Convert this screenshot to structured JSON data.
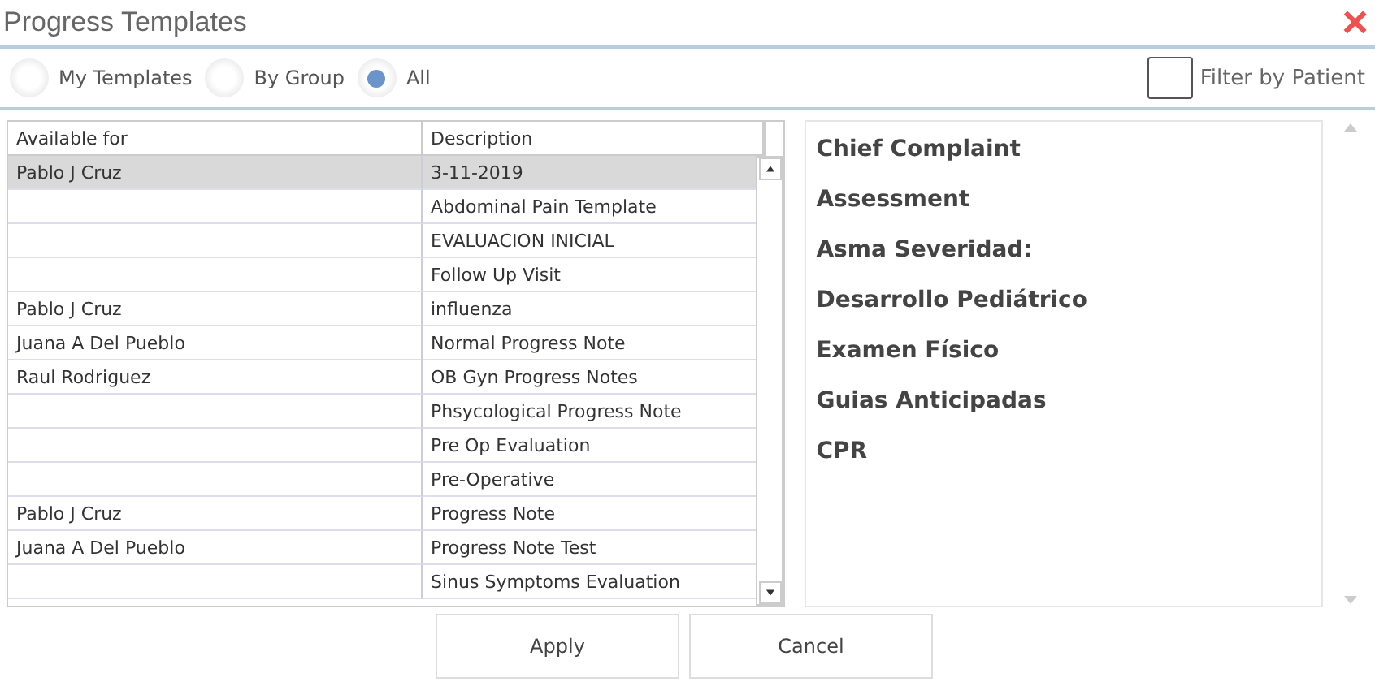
{
  "window": {
    "title": "Progress Templates",
    "close": "×"
  },
  "filters": [
    {
      "label": "My Templates",
      "selected": false
    },
    {
      "label": "By Group",
      "selected": false
    },
    {
      "label": "All",
      "selected": true
    }
  ],
  "filter_by_patient": {
    "label": "Filter by Patient",
    "checked": false
  },
  "table": {
    "columns": [
      "Available for",
      "Description"
    ],
    "rows": [
      {
        "available_for": "Pablo J Cruz",
        "description": "3-11-2019",
        "selected": true
      },
      {
        "available_for": "",
        "description": "Abdominal Pain Template",
        "selected": false
      },
      {
        "available_for": "",
        "description": "EVALUACION INICIAL",
        "selected": false
      },
      {
        "available_for": "",
        "description": "Follow Up Visit",
        "selected": false
      },
      {
        "available_for": "Pablo J Cruz",
        "description": "influenza",
        "selected": false
      },
      {
        "available_for": "Juana A Del Pueblo",
        "description": "Normal Progress Note",
        "selected": false
      },
      {
        "available_for": "Raul Rodriguez",
        "description": "OB Gyn Progress Notes",
        "selected": false
      },
      {
        "available_for": "",
        "description": "Phsycological Progress Note",
        "selected": false
      },
      {
        "available_for": "",
        "description": "Pre Op Evaluation",
        "selected": false
      },
      {
        "available_for": "",
        "description": "Pre-Operative",
        "selected": false
      },
      {
        "available_for": "Pablo J Cruz",
        "description": "Progress Note",
        "selected": false
      },
      {
        "available_for": "Juana A Del Pueblo",
        "description": "Progress Note Test",
        "selected": false
      },
      {
        "available_for": "",
        "description": "Sinus Symptoms Evaluation",
        "selected": false
      }
    ]
  },
  "preview": {
    "sections": [
      "Chief Complaint",
      "Assessment",
      "Asma Severidad:",
      "Desarrollo Pediátrico",
      "Examen Físico",
      "Guias Anticipadas",
      "CPR"
    ]
  },
  "buttons": [
    "Apply",
    "Cancel"
  ]
}
